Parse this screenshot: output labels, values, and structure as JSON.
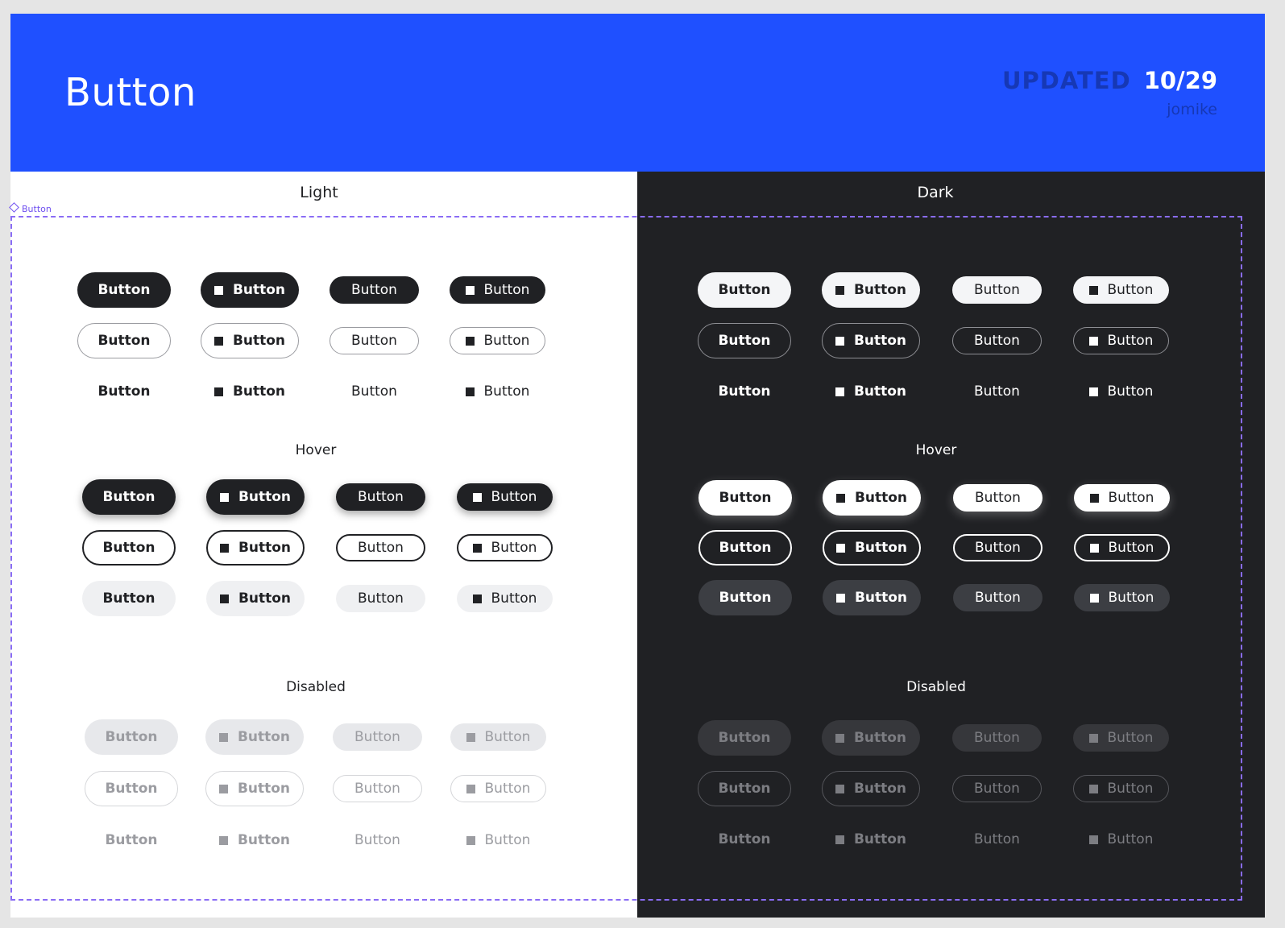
{
  "header": {
    "title": "Button",
    "updated_label": "UPDATED",
    "updated_date": "10/29",
    "author": "jomike",
    "brand_color": "#1f50ff"
  },
  "component_tag": "Button",
  "light": {
    "label": "Light",
    "hover_label": "Hover",
    "disabled_label": "Disabled"
  },
  "dark": {
    "label": "Dark",
    "hover_label": "Hover",
    "disabled_label": "Disabled"
  },
  "button_label": "Button",
  "icon_name": "square-icon"
}
